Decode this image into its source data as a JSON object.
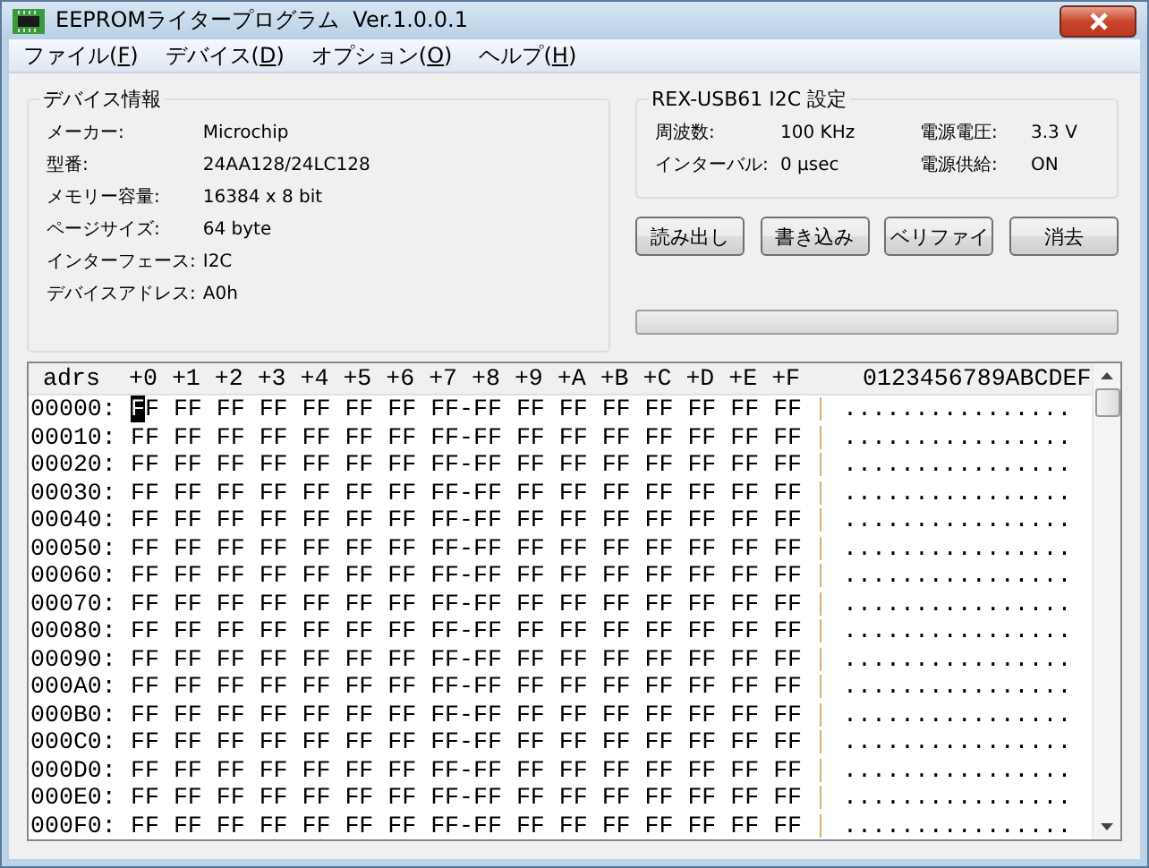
{
  "window": {
    "title": "EEPROMライタープログラム  Ver.1.0.0.1"
  },
  "menu": [
    {
      "label": "ファイル(",
      "key": "F",
      "end": ")"
    },
    {
      "label": "デバイス(",
      "key": "D",
      "end": ")"
    },
    {
      "label": "オプション(",
      "key": "O",
      "end": ")"
    },
    {
      "label": "ヘルプ(",
      "key": "H",
      "end": ")"
    }
  ],
  "device_info": {
    "title": "デバイス情報",
    "fields": [
      {
        "label": "メーカー:",
        "value": "Microchip"
      },
      {
        "label": "型番:",
        "value": "24AA128/24LC128"
      },
      {
        "label": "メモリー容量:",
        "value": "16384 x 8 bit"
      },
      {
        "label": "ページサイズ:",
        "value": "64 byte"
      },
      {
        "label": "インターフェース:",
        "value": "I2C"
      },
      {
        "label": "デバイスアドレス:",
        "value": "A0h"
      }
    ]
  },
  "settings": {
    "title": "REX-USB61 I2C 設定",
    "fields": [
      {
        "label": "周波数:",
        "value": "100 KHz"
      },
      {
        "label": "電源電圧:",
        "value": "3.3 V"
      },
      {
        "label": "インターバル:",
        "value": "0 μsec"
      },
      {
        "label": "電源供給:",
        "value": "ON"
      }
    ]
  },
  "buttons": [
    "読み出し",
    "書き込み",
    "ベリファイ",
    "消去"
  ],
  "progress": {
    "level": 0
  },
  "hex_view": {
    "header": {
      "address": "adrs",
      "columns": "+0 +1 +2 +3 +4 +5 +6 +7 +8 +9 +A +B +C +D +E +F",
      "ascii": "0123456789ABCDEF"
    },
    "rows": [
      {
        "address": "00000:",
        "hex": "FF FF FF FF FF FF FF FF-FF FF FF FF FF FF FF FF",
        "ascii": "................",
        "cursor": true
      },
      {
        "address": "00010:",
        "hex": "FF FF FF FF FF FF FF FF-FF FF FF FF FF FF FF FF",
        "ascii": "................",
        "cursor": false
      },
      {
        "address": "00020:",
        "hex": "FF FF FF FF FF FF FF FF-FF FF FF FF FF FF FF FF",
        "ascii": "................",
        "cursor": false
      },
      {
        "address": "00030:",
        "hex": "FF FF FF FF FF FF FF FF-FF FF FF FF FF FF FF FF",
        "ascii": "................",
        "cursor": false
      },
      {
        "address": "00040:",
        "hex": "FF FF FF FF FF FF FF FF-FF FF FF FF FF FF FF FF",
        "ascii": "................",
        "cursor": false
      },
      {
        "address": "00050:",
        "hex": "FF FF FF FF FF FF FF FF-FF FF FF FF FF FF FF FF",
        "ascii": "................",
        "cursor": false
      },
      {
        "address": "00060:",
        "hex": "FF FF FF FF FF FF FF FF-FF FF FF FF FF FF FF FF",
        "ascii": "................",
        "cursor": false
      },
      {
        "address": "00070:",
        "hex": "FF FF FF FF FF FF FF FF-FF FF FF FF FF FF FF FF",
        "ascii": "................",
        "cursor": false
      },
      {
        "address": "00080:",
        "hex": "FF FF FF FF FF FF FF FF-FF FF FF FF FF FF FF FF",
        "ascii": "................",
        "cursor": false
      },
      {
        "address": "00090:",
        "hex": "FF FF FF FF FF FF FF FF-FF FF FF FF FF FF FF FF",
        "ascii": "................",
        "cursor": false
      },
      {
        "address": "000A0:",
        "hex": "FF FF FF FF FF FF FF FF-FF FF FF FF FF FF FF FF",
        "ascii": "................",
        "cursor": false
      },
      {
        "address": "000B0:",
        "hex": "FF FF FF FF FF FF FF FF-FF FF FF FF FF FF FF FF",
        "ascii": "................",
        "cursor": false
      },
      {
        "address": "000C0:",
        "hex": "FF FF FF FF FF FF FF FF-FF FF FF FF FF FF FF FF",
        "ascii": "................",
        "cursor": false
      },
      {
        "address": "000D0:",
        "hex": "FF FF FF FF FF FF FF FF-FF FF FF FF FF FF FF FF",
        "ascii": "................",
        "cursor": false
      },
      {
        "address": "000E0:",
        "hex": "FF FF FF FF FF FF FF FF-FF FF FF FF FF FF FF FF",
        "ascii": "................",
        "cursor": false
      },
      {
        "address": "000F0:",
        "hex": "FF FF FF FF FF FF FF FF-FF FF FF FF FF FF FF FF",
        "ascii": "................",
        "cursor": false
      }
    ]
  }
}
